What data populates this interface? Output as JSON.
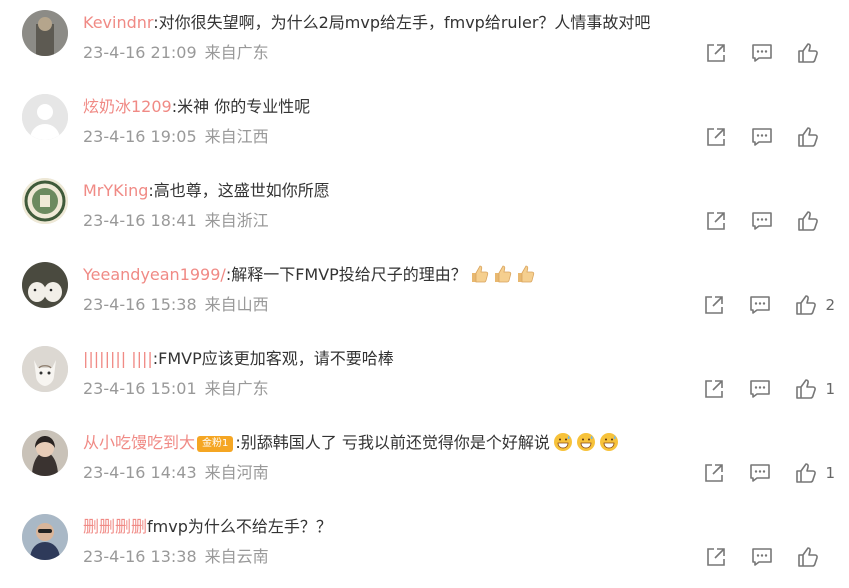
{
  "comments": [
    {
      "username": "Kevindnr",
      "text": "对你很失望啊，为什么2局mvp给左手，fmvp给ruler？人情事故对吧",
      "date": "23-4-16 21:09",
      "location": "来自广东",
      "likes": "",
      "avatar": "avatar-person"
    },
    {
      "username": "炫奶冰1209",
      "text": "米神 你的专业性呢",
      "date": "23-4-16 19:05",
      "location": "来自江西",
      "likes": "",
      "avatar": "default-avatar"
    },
    {
      "username": "MrYKing",
      "text": "高也尊，这盛世如你所愿",
      "date": "23-4-16 18:41",
      "location": "来自浙江",
      "likes": "",
      "avatar": "seal-avatar"
    },
    {
      "username": "Yeeandyean1999/",
      "text": "解释一下FMVP投给尺子的理由？",
      "date": "23-4-16 15:38",
      "location": "来自山西",
      "likes": "2",
      "avatar": "dogs-avatar"
    },
    {
      "username": "||||||||  ||||",
      "text": "FMVP应该更加客观，请不要哈棒",
      "date": "23-4-16 15:01",
      "location": "来自广东",
      "likes": "1",
      "avatar": "cat-avatar"
    },
    {
      "username": "从小吃馒吃到大",
      "badge": "金粉1",
      "text": "别舔韩国人了  亏我以前还觉得你是个好解说",
      "date": "23-4-16 14:43",
      "location": "来自河南",
      "likes": "1",
      "avatar": "girl-avatar"
    },
    {
      "username": "删删删删",
      "text": "fmvp为什么不给左手？？",
      "date": "23-4-16 13:38",
      "location": "来自云南",
      "likes": "",
      "avatar": "man-avatar"
    }
  ],
  "colors": {
    "username": "#f08a85",
    "text": "#333333",
    "meta": "#999999",
    "icon": "#777777"
  },
  "icons": {
    "share": "share-icon",
    "comment": "comment-icon",
    "like": "like-icon",
    "emoji_thumb": "thumbs-up-emoji",
    "emoji_grin": "grin-sweat-emoji"
  }
}
